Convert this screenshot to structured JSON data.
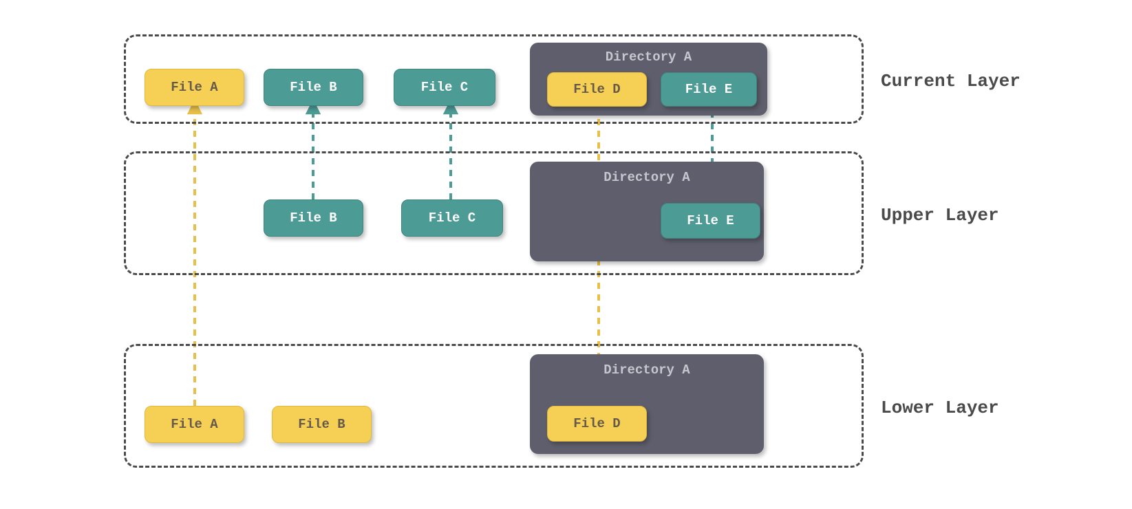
{
  "layers": {
    "current": {
      "label": "Current Layer"
    },
    "upper": {
      "label": "Upper Layer"
    },
    "lower": {
      "label": "Lower Layer"
    }
  },
  "directory": {
    "label": "Directory A"
  },
  "files": {
    "a": "File A",
    "b": "File B",
    "c": "File C",
    "d": "File D",
    "e": "File E"
  },
  "colors": {
    "yellow": "#f6cf55",
    "teal": "#4d9b95",
    "dir": "#5f5e6c",
    "border": "#4a4a4a"
  }
}
